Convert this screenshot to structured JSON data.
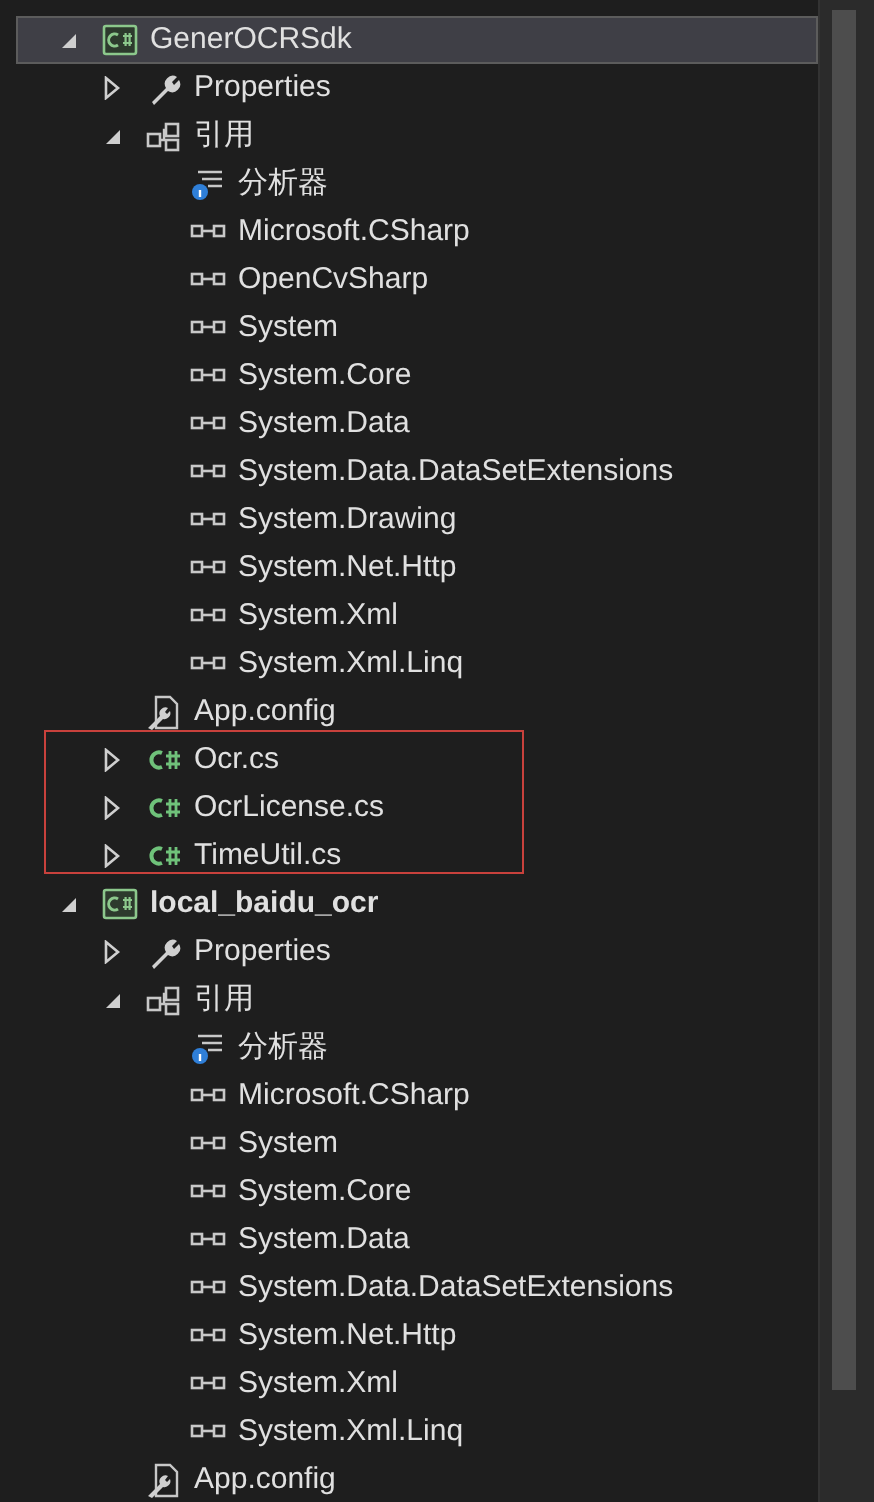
{
  "solution": {
    "projects": [
      {
        "label": "GenerOCRSdk",
        "kind": "project",
        "expanded": true,
        "selected": true,
        "startup": false,
        "children": [
          {
            "label": "Properties",
            "kind": "properties",
            "expanded": false
          },
          {
            "label": "引用",
            "kind": "references",
            "expanded": true,
            "children": [
              {
                "label": "分析器",
                "kind": "analyzer"
              },
              {
                "label": "Microsoft.CSharp",
                "kind": "reference"
              },
              {
                "label": "OpenCvSharp",
                "kind": "reference"
              },
              {
                "label": "System",
                "kind": "reference"
              },
              {
                "label": "System.Core",
                "kind": "reference"
              },
              {
                "label": "System.Data",
                "kind": "reference"
              },
              {
                "label": "System.Data.DataSetExtensions",
                "kind": "reference"
              },
              {
                "label": "System.Drawing",
                "kind": "reference"
              },
              {
                "label": "System.Net.Http",
                "kind": "reference"
              },
              {
                "label": "System.Xml",
                "kind": "reference"
              },
              {
                "label": "System.Xml.Linq",
                "kind": "reference"
              }
            ]
          },
          {
            "label": "App.config",
            "kind": "config"
          },
          {
            "label": "Ocr.cs",
            "kind": "csfile",
            "expanded": false,
            "marked": true
          },
          {
            "label": "OcrLicense.cs",
            "kind": "csfile",
            "expanded": false,
            "marked": true
          },
          {
            "label": "TimeUtil.cs",
            "kind": "csfile",
            "expanded": false,
            "marked": true
          }
        ]
      },
      {
        "label": "local_baidu_ocr",
        "kind": "project",
        "expanded": true,
        "selected": false,
        "startup": true,
        "children": [
          {
            "label": "Properties",
            "kind": "properties",
            "expanded": false
          },
          {
            "label": "引用",
            "kind": "references",
            "expanded": true,
            "children": [
              {
                "label": "分析器",
                "kind": "analyzer"
              },
              {
                "label": "Microsoft.CSharp",
                "kind": "reference"
              },
              {
                "label": "System",
                "kind": "reference"
              },
              {
                "label": "System.Core",
                "kind": "reference"
              },
              {
                "label": "System.Data",
                "kind": "reference"
              },
              {
                "label": "System.Data.DataSetExtensions",
                "kind": "reference"
              },
              {
                "label": "System.Net.Http",
                "kind": "reference"
              },
              {
                "label": "System.Xml",
                "kind": "reference"
              },
              {
                "label": "System.Xml.Linq",
                "kind": "reference"
              }
            ]
          },
          {
            "label": "App.config",
            "kind": "config"
          }
        ]
      }
    ]
  }
}
